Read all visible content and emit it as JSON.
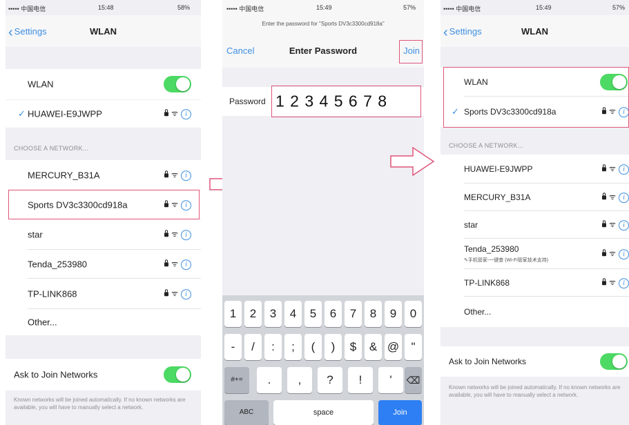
{
  "panel1": {
    "status": {
      "carrier": "••••• 中国电信",
      "time": "15:48",
      "battery": "58%"
    },
    "nav": {
      "back_label": "Settings",
      "title": "WLAN"
    },
    "wlan_label": "WLAN",
    "wlan_on": true,
    "connected_network": "HUAWEI-E9JWPP",
    "section_header": "CHOOSE A NETWORK...",
    "networks": [
      "MERCURY_B31A",
      "Sports DV3c3300cd918a",
      "star",
      "Tenda_253980",
      "TP-LINK868"
    ],
    "other_label": "Other...",
    "ask_label": "Ask to Join Networks",
    "ask_on": true,
    "footer": "Known networks will be joined automatically. If no known networks are available, you will have to manually select a network."
  },
  "panel2": {
    "status": {
      "carrier": "••••• 中国电信",
      "time": "15:49",
      "battery": "57%"
    },
    "prompt": "Enter the password for \"Sports DV3c3300cd918a\"",
    "cancel_label": "Cancel",
    "title": "Enter Password",
    "join_label": "Join",
    "password_label": "Password",
    "password_value": "1 2 3 4 5 6 7 8",
    "keyboard": {
      "row1": [
        "1",
        "2",
        "3",
        "4",
        "5",
        "6",
        "7",
        "8",
        "9",
        "0"
      ],
      "row2": [
        "-",
        "/",
        ":",
        ";",
        "(",
        ")",
        "$",
        "&",
        "@",
        "\""
      ],
      "row3_left": "#+=",
      "row3": [
        ".",
        ",",
        "?",
        "!",
        "'"
      ],
      "delete_icon": "backspace-icon",
      "abc_label": "ABC",
      "space_label": "space",
      "join_label": "Join"
    }
  },
  "panel3": {
    "status": {
      "carrier": "••••• 中国电信",
      "time": "15:49",
      "battery": "57%"
    },
    "nav": {
      "back_label": "Settings",
      "title": "WLAN"
    },
    "wlan_label": "WLAN",
    "wlan_on": true,
    "connected_network": "Sports DV3c3300cd918a",
    "section_header": "CHOOSE A NETWORK...",
    "networks": [
      {
        "name": "HUAWEI-E9JWPP"
      },
      {
        "name": "MERCURY_B31A"
      },
      {
        "name": "star"
      },
      {
        "name": "Tenda_253980",
        "subtitle": "✎手机管家-一键查 (Wi-Fi管家技术支持)"
      },
      {
        "name": "TP-LINK868"
      }
    ],
    "other_label": "Other...",
    "ask_label": "Ask to Join Networks",
    "ask_on": true,
    "footer": "Known networks will be joined automatically. If no known networks are available, you will have to manually select a network."
  },
  "colors": {
    "accent": "#3d8fe0",
    "toggle_on": "#4cd964",
    "highlight": "#e0557a",
    "keyboard_blue": "#2e7ff3"
  },
  "icons": {
    "lock": "lock-icon",
    "wifi": "wifi-icon",
    "info": "info-icon",
    "arrow": "right-arrow-icon"
  }
}
